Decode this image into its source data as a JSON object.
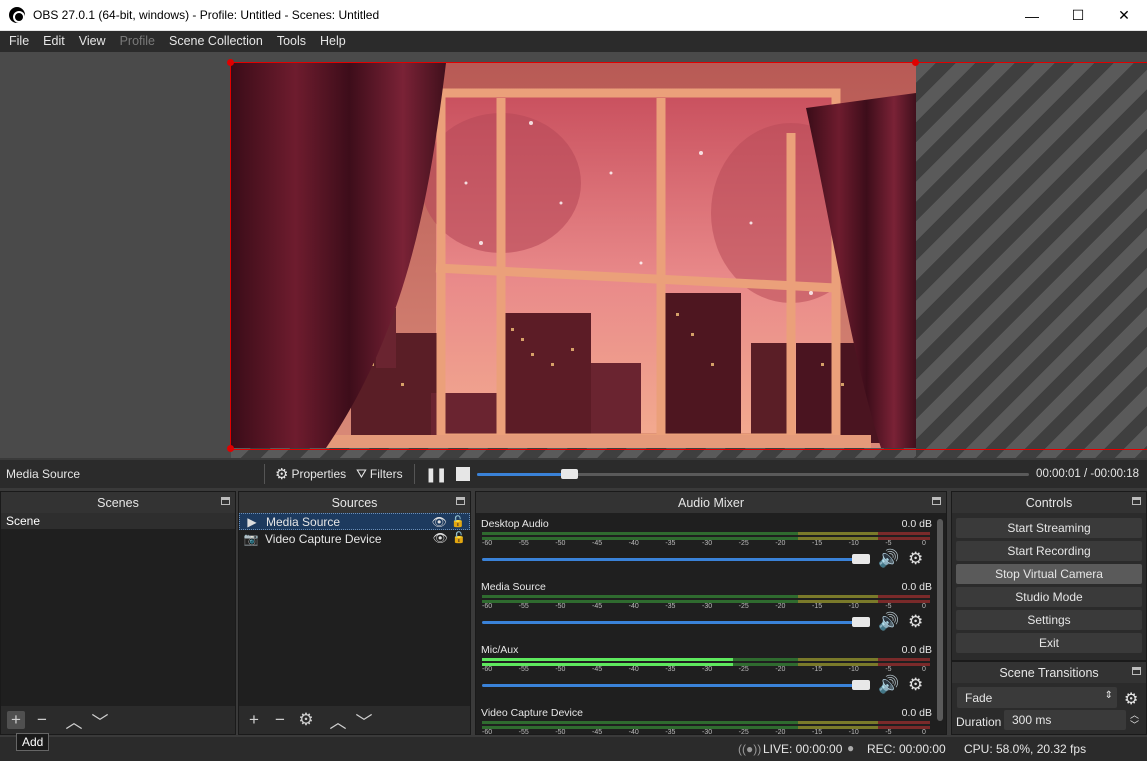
{
  "window": {
    "title": "OBS 27.0.1 (64-bit, windows) - Profile: Untitled - Scenes: Untitled",
    "minimize": "—",
    "maximize": "☐",
    "close": "✕"
  },
  "menu": [
    "File",
    "Edit",
    "View",
    "Profile",
    "Scene Collection",
    "Tools",
    "Help"
  ],
  "source_toolbar": {
    "source_name": "Media Source",
    "properties_label": "Properties",
    "filters_label": "Filters",
    "time": "00:00:01 / -00:00:18",
    "progress": 0.06
  },
  "scenes": {
    "header": "Scenes",
    "items": [
      "Scene"
    ],
    "tooltip": "Add"
  },
  "sources": {
    "header": "Sources",
    "items": [
      {
        "name": "Media Source",
        "icon": "play-icon",
        "selected": true
      },
      {
        "name": "Video Capture Device",
        "icon": "camera-icon",
        "selected": false
      }
    ]
  },
  "audio_mixer": {
    "header": "Audio Mixer",
    "ticks": [
      "-60",
      "-55",
      "-50",
      "-45",
      "-40",
      "-35",
      "-30",
      "-25",
      "-20",
      "-15",
      "-10",
      "-5",
      "0"
    ],
    "channels": [
      {
        "name": "Desktop Audio",
        "db": "0.0 dB",
        "level": 0.0
      },
      {
        "name": "Media Source",
        "db": "0.0 dB",
        "level": 0.0
      },
      {
        "name": "Mic/Aux",
        "db": "0.0 dB",
        "level": 0.56
      },
      {
        "name": "Video Capture Device",
        "db": "0.0 dB",
        "level": 0.0
      }
    ]
  },
  "controls": {
    "header": "Controls",
    "buttons": [
      "Start Streaming",
      "Start Recording",
      "Stop Virtual Camera",
      "Studio Mode",
      "Settings",
      "Exit"
    ]
  },
  "scene_transitions": {
    "header": "Scene Transitions",
    "transition": "Fade",
    "duration_label": "Duration",
    "duration": "300 ms"
  },
  "status": {
    "live": "LIVE: 00:00:00",
    "rec": "REC: 00:00:00",
    "cpu": "CPU: 58.0%, 20.32 fps"
  }
}
